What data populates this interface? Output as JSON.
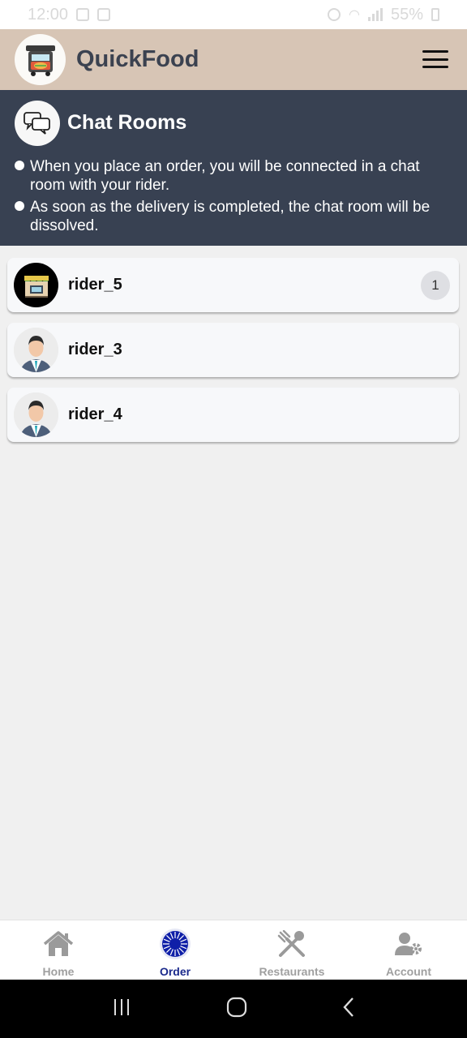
{
  "status_bar": {
    "time": "12:00",
    "battery": "55%"
  },
  "header": {
    "app_title": "QuickFood",
    "logo_icon": "food-truck-logo-icon",
    "menu_icon": "hamburger-menu-icon"
  },
  "info": {
    "title": "Chat Rooms",
    "bullets": [
      "When you place an order, you will be connected in a chat room with your rider.",
      "As soon as the delivery is completed, the chat room will be dissolved."
    ]
  },
  "chats": [
    {
      "name": "rider_5",
      "avatar": "shop-storefront-avatar",
      "unread": "1"
    },
    {
      "name": "rider_3",
      "avatar": "person-avatar",
      "unread": ""
    },
    {
      "name": "rider_4",
      "avatar": "person-avatar",
      "unread": ""
    }
  ],
  "nav": {
    "items": [
      {
        "label": "Home",
        "icon": "home-icon"
      },
      {
        "label": "Order",
        "icon": "order-icon",
        "active": true
      },
      {
        "label": "Restaurants",
        "icon": "fork-spoon-icon"
      },
      {
        "label": "Account",
        "icon": "account-settings-icon"
      }
    ]
  },
  "colors": {
    "header_bg": "#d7c5b5",
    "panel_bg": "#384152",
    "active_nav": "#1b2a8c"
  }
}
